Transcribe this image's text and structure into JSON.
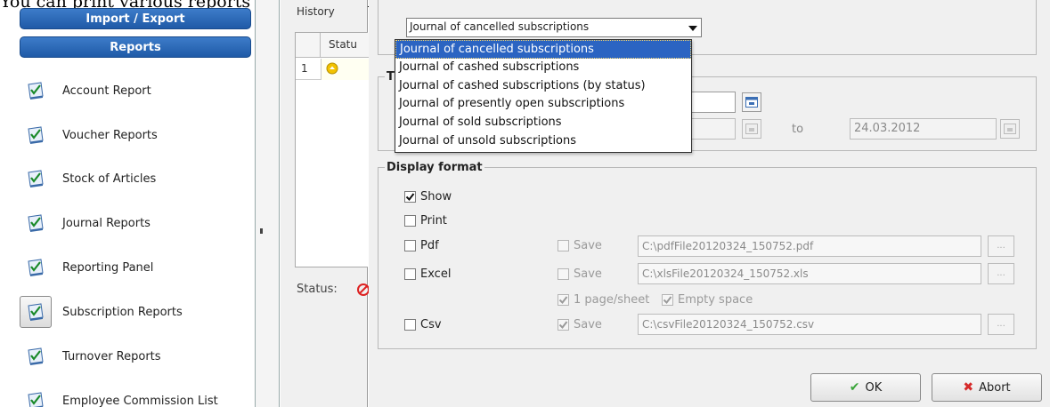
{
  "caption": "You can print various reports on you subscriptions from Reports - Subscription reports.",
  "sidebar": {
    "headers": [
      "Import / Export",
      "Reports"
    ],
    "items": [
      {
        "label": "Account Report",
        "icon": "report-check-icon",
        "active": false
      },
      {
        "label": "Voucher Reports",
        "icon": "report-check-icon",
        "active": false
      },
      {
        "label": "Stock of Articles",
        "icon": "report-check-icon",
        "active": false
      },
      {
        "label": "Journal Reports",
        "icon": "report-check-icon",
        "active": false
      },
      {
        "label": "Reporting Panel",
        "icon": "report-check-icon",
        "active": false
      },
      {
        "label": "Subscription Reports",
        "icon": "report-check-icon",
        "active": true
      },
      {
        "label": "Turnover Reports",
        "icon": "report-check-icon",
        "active": false
      },
      {
        "label": "Employee Commission List",
        "icon": "report-check-icon",
        "active": false
      }
    ]
  },
  "history": {
    "title": "History",
    "column": "Statu",
    "rows": [
      {
        "num": "1",
        "status_color": "#f2c200"
      }
    ]
  },
  "status": {
    "label": "Status:",
    "icon": "no-entry-icon"
  },
  "report_select": {
    "value": "Journal of cancelled subscriptions",
    "options": [
      "Journal of cancelled subscriptions",
      "Journal of cashed subscriptions",
      "Journal of cashed subscriptions (by status)",
      "Journal of presently open subscriptions",
      "Journal of sold subscriptions",
      "Journal of unsold subscriptions"
    ],
    "selected_index": 0
  },
  "time": {
    "legend": "Ti",
    "to_label": "to",
    "to_date": "24.03.2012"
  },
  "display_format": {
    "legend": "Display format",
    "show": {
      "label": "Show",
      "checked": true
    },
    "print": {
      "label": "Print",
      "checked": false
    },
    "pdf": {
      "label": "Pdf",
      "checked": false,
      "save_label": "Save",
      "save_checked": false,
      "path": "C:\\pdfFile20120324_150752.pdf"
    },
    "excel": {
      "label": "Excel",
      "checked": false,
      "save_label": "Save",
      "save_checked": false,
      "path": "C:\\xlsFile20120324_150752.xls",
      "one_page_label": "1 page/sheet",
      "one_page_checked": true,
      "empty_space_label": "Empty space",
      "empty_space_checked": true
    },
    "csv": {
      "label": "Csv",
      "checked": false,
      "save_label": "Save",
      "save_checked": true,
      "path": "C:\\csvFile20120324_150752.csv"
    },
    "browse_label": "..."
  },
  "buttons": {
    "ok": "OK",
    "abort": "Abort"
  },
  "colors": {
    "accent": "#2b64c2",
    "header": "#1f5aa7",
    "ok_icon": "#3aa53a",
    "abort_icon": "#d62a2a"
  }
}
